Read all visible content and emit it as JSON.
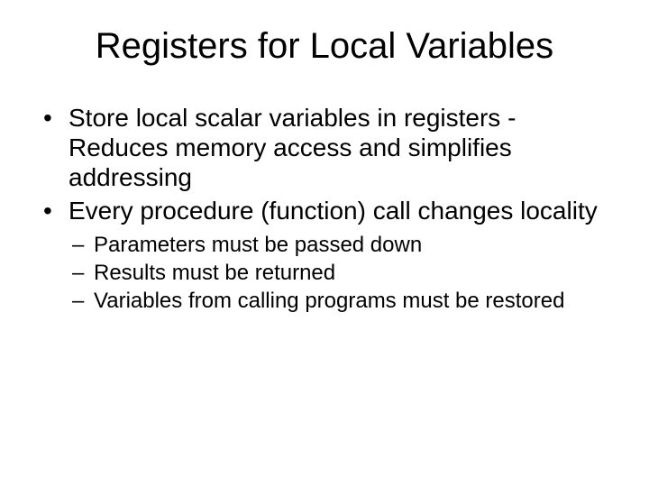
{
  "title": "Registers for Local Variables",
  "bullets": [
    "Store local scalar variables in registers - Reduces memory access and simplifies addressing",
    "Every procedure (function) call changes locality"
  ],
  "subbullets": [
    "Parameters must be passed down",
    "Results must be returned",
    "Variables from calling programs must be restored"
  ]
}
